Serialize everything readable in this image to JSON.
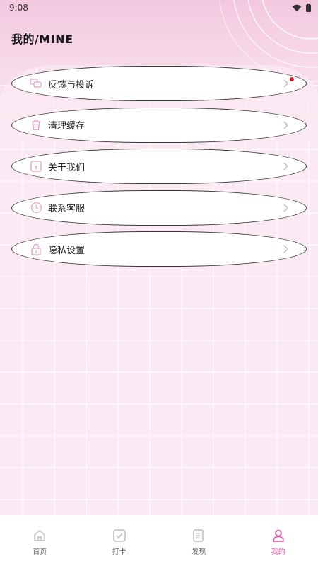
{
  "status_bar": {
    "time": "9:08"
  },
  "page_title": "我的/MINE",
  "menu": {
    "items": [
      {
        "label": "反馈与投诉",
        "icon": "chat-bubbles-icon",
        "badge": true
      },
      {
        "label": "清理缓存",
        "icon": "trash-icon",
        "badge": false
      },
      {
        "label": "关于我们",
        "icon": "info-icon",
        "badge": false
      },
      {
        "label": "联系客服",
        "icon": "clock-service-icon",
        "badge": false
      },
      {
        "label": "隐私设置",
        "icon": "lock-icon",
        "badge": false
      }
    ]
  },
  "tabbar": {
    "tabs": [
      {
        "label": "首页",
        "icon": "home-icon",
        "active": false
      },
      {
        "label": "打卡",
        "icon": "checkin-icon",
        "active": false
      },
      {
        "label": "发现",
        "icon": "discover-icon",
        "active": false
      },
      {
        "label": "我的",
        "icon": "profile-icon",
        "active": true
      }
    ]
  },
  "colors": {
    "accent": "#d94fa0",
    "icon": "#e7a2c7",
    "badge": "#e0161b"
  }
}
